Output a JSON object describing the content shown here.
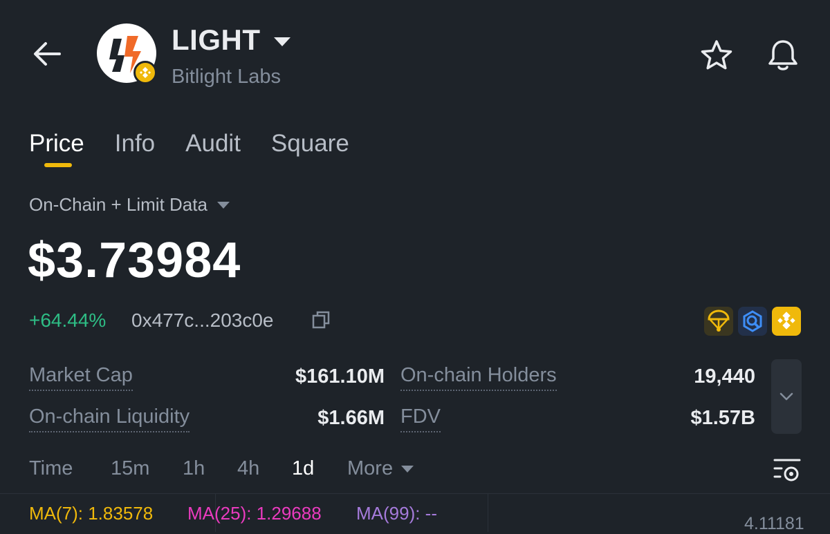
{
  "header": {
    "title": "LIGHT",
    "subtitle": "Bitlight Labs",
    "icons": [
      "back-arrow-icon",
      "token-logo",
      "bnb-chain-badge-icon",
      "star-icon",
      "bell-icon"
    ]
  },
  "tabs": [
    {
      "label": "Price",
      "active": true
    },
    {
      "label": "Info",
      "active": false
    },
    {
      "label": "Audit",
      "active": false
    },
    {
      "label": "Square",
      "active": false
    }
  ],
  "data_source": "On-Chain + Limit Data",
  "price": "$3.73984",
  "change": "+64.44%",
  "contract": "0x477c...203c0e",
  "badge_icons": [
    "parachute-icon",
    "search-audit-icon",
    "bnb-icon"
  ],
  "stats": {
    "market_cap": {
      "label": "Market Cap",
      "value": "$161.10M"
    },
    "holders": {
      "label": "On-chain Holders",
      "value": "19,440"
    },
    "liquidity": {
      "label": "On-chain Liquidity",
      "value": "$1.66M"
    },
    "fdv": {
      "label": "FDV",
      "value": "$1.57B"
    }
  },
  "intervals": {
    "time": "Time",
    "options": [
      "15m",
      "1h",
      "4h",
      "1d"
    ],
    "selected": "1d",
    "more": "More"
  },
  "ma": {
    "ma7": "MA(7): 1.83578",
    "ma25": "MA(25): 1.29688",
    "ma99": "MA(99): --"
  },
  "axis_value": "4.11181",
  "colors": {
    "background": "#1e2329",
    "accent": "#f0b90b",
    "up": "#2ebd85",
    "ma7": "#f0b90b",
    "ma25": "#ea3bbf",
    "ma99": "#a67bdc"
  }
}
